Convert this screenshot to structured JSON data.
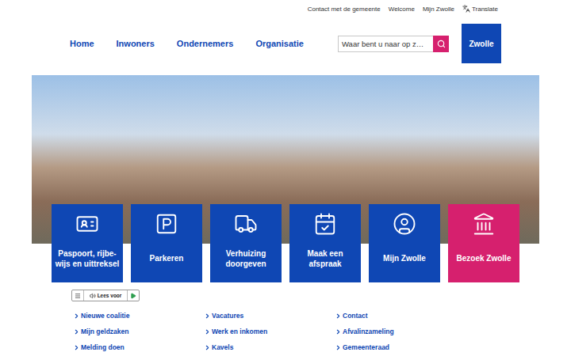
{
  "utility_links": [
    "Contact met de gemeente",
    "Welcome",
    "Mijn Zwolle"
  ],
  "translate": "Translate",
  "nav": [
    "Home",
    "Inwoners",
    "Ondernemers",
    "Organisatie"
  ],
  "search": {
    "placeholder": "Waar bent u naar op z…"
  },
  "logo": "Zwolle",
  "tiles": [
    {
      "label": "Paspoort, rijbe-wijs en uittreksel",
      "color": "#0f47b4"
    },
    {
      "label": "Parkeren",
      "color": "#0f47b4"
    },
    {
      "label": "Verhuizing doorgeven",
      "color": "#0f47b4"
    },
    {
      "label": "Maak een afspraak",
      "color": "#0f47b4"
    },
    {
      "label": "Mijn Zwolle",
      "color": "#0f47b4"
    },
    {
      "label": "Bezoek Zwolle",
      "color": "#d6206e"
    }
  ],
  "readspeaker": {
    "label": "Lees voor"
  },
  "quick_links": [
    "Nieuwe coalitie",
    "Vacatures",
    "Contact",
    "Mijn geldzaken",
    "Werk en inkomen",
    "Afvalinzameling",
    "Melding doen",
    "Kavels",
    "Gemeenteraad"
  ]
}
